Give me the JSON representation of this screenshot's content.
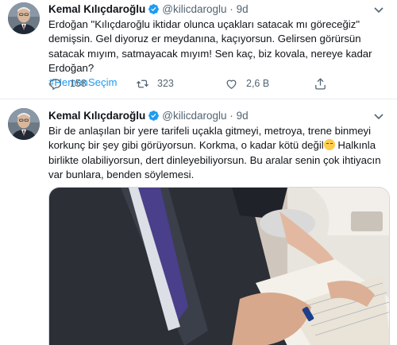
{
  "tweets": [
    {
      "author": {
        "name": "Kemal Kılıçdaroğlu",
        "handle": "@kilicdaroglu",
        "time": "9d"
      },
      "text": "Erdoğan \"Kılıçdaroğlu iktidar olunca uçakları satacak mı göreceğiz\" demişsin. Gel diyoruz er meydanına, kaçıyorsun. Gelirsen görürsün satacak mıyım, satmayacak mıyım! Sen kaç, biz kovala, nereye kadar Erdoğan?",
      "hashtag": "#HemenSeçim",
      "stats": {
        "replies": "158",
        "retweets": "323",
        "likes": "2,6 B"
      }
    },
    {
      "author": {
        "name": "Kemal Kılıçdaroğlu",
        "handle": "@kilicdaroglu",
        "time": "9d"
      },
      "text_before_emoji": "Bir de anlaşılan bir yere tarifeli uçakla gitmeyi, metroya, trene binmeyi korkunç bir şey gibi görüyorsun. Korkma, o kadar kötü değil",
      "text_after_emoji": " Halkınla birlikte olabiliyorsun, dert dinleyebiliyorsun. Bu aralar senin çok ihtiyacın var bunlara, benden söylemesi."
    }
  ],
  "ui": {
    "separator": "·",
    "accent_color": "#1d9bf0",
    "icons": [
      "verified-badge-icon",
      "chevron-down-icon",
      "reply-icon",
      "retweet-icon",
      "like-icon",
      "share-icon",
      "emoji-relieved-icon"
    ]
  }
}
